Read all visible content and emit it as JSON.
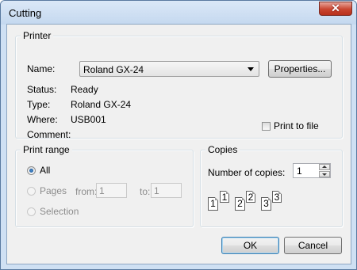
{
  "window": {
    "title": "Cutting",
    "close_glyph": "✕"
  },
  "printer": {
    "legend": "Printer",
    "name_label": "Name:",
    "name_value": "Roland GX-24",
    "properties_label": "Properties...",
    "status_label": "Status:",
    "status_value": "Ready",
    "type_label": "Type:",
    "type_value": "Roland GX-24",
    "where_label": "Where:",
    "where_value": "USB001",
    "comment_label": "Comment:",
    "print_to_file_label": "Print to file",
    "print_to_file_checked": false
  },
  "print_range": {
    "legend": "Print range",
    "all_label": "All",
    "pages_label": "Pages",
    "from_label": "from:",
    "from_value": "1",
    "to_label": "to:",
    "to_value": "1",
    "selection_label": "Selection",
    "selected": "All"
  },
  "copies": {
    "legend": "Copies",
    "number_label": "Number of copies:",
    "number_value": "1",
    "collate_pages": [
      "1",
      "1",
      "2",
      "2",
      "3",
      "3"
    ]
  },
  "buttons": {
    "ok_label": "OK",
    "cancel_label": "Cancel"
  },
  "icons": {
    "close": "close-icon",
    "dropdown": "chevron-down-icon",
    "spin_up": "spin-up-icon",
    "spin_down": "spin-down-icon",
    "collate": "collate-pages-icon"
  },
  "colors": {
    "title_bar": "#c4d8ef",
    "close_button": "#c9452f",
    "dialog_background": "#f0f0f0",
    "radio_selected": "#1a4f8f"
  }
}
